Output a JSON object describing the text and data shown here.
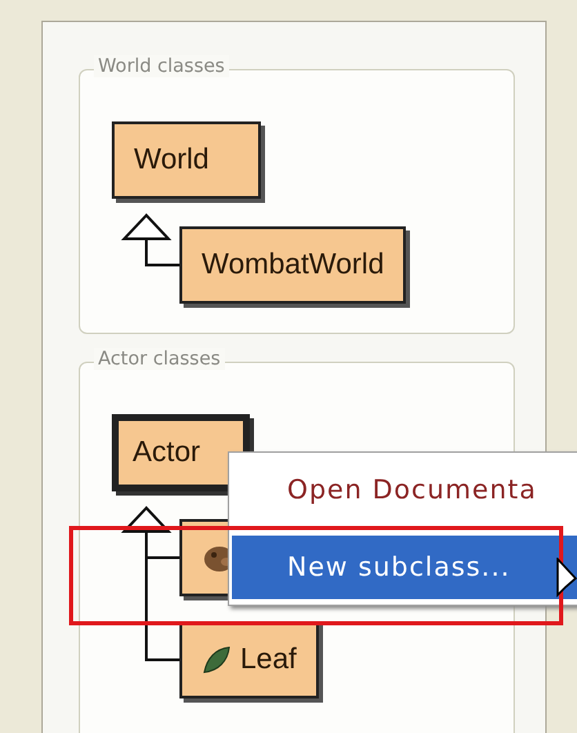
{
  "world_classes": {
    "legend": "World classes",
    "classes": [
      {
        "name": "World",
        "selected": false,
        "children": [
          {
            "name": "WombatWorld",
            "selected": false
          }
        ]
      }
    ]
  },
  "actor_classes": {
    "legend": "Actor classes",
    "classes": [
      {
        "name": "Actor",
        "selected": true,
        "children": [
          {
            "kind": "animal",
            "selected": false
          },
          {
            "name": "Leaf",
            "kind": "leaf",
            "selected": false
          }
        ]
      }
    ]
  },
  "context_menu": {
    "items": [
      {
        "label": "Open Documenta",
        "selected": false
      },
      {
        "label": "New subclass...",
        "selected": true
      }
    ]
  }
}
